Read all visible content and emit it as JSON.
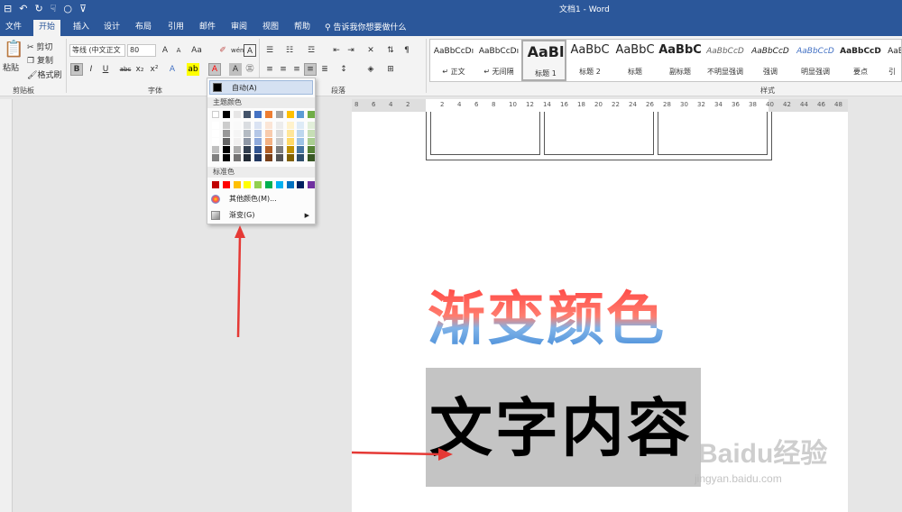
{
  "window": {
    "title": "文档1 - Word"
  },
  "qat": {
    "save": "⊟",
    "undo": "↶",
    "redo": "↻",
    "touch": "☟",
    "circle": "○",
    "more": "⊽"
  },
  "tabs": [
    {
      "label": "文件"
    },
    {
      "label": "开始"
    },
    {
      "label": "插入"
    },
    {
      "label": "设计"
    },
    {
      "label": "布局"
    },
    {
      "label": "引用"
    },
    {
      "label": "邮件"
    },
    {
      "label": "审阅"
    },
    {
      "label": "视图"
    },
    {
      "label": "帮助"
    }
  ],
  "tellme": "告诉我你想要做什么",
  "clipboard": {
    "paste": "粘贴",
    "cut": "剪切",
    "copy": "复制",
    "format_painter": "格式刷",
    "group": "剪贴板"
  },
  "font": {
    "name": "等线 (中文正文",
    "size": "80",
    "group": "字体",
    "bold": "B",
    "italic": "I",
    "underline": "U",
    "strike": "abc",
    "sub": "x₂",
    "sup": "x²",
    "grow": "A",
    "shrink": "A",
    "case": "Aa",
    "color_a": "A"
  },
  "paragraph": {
    "group": "段落"
  },
  "styles": {
    "group": "样式",
    "items": [
      {
        "sample": "AaBbCcDı",
        "name": "↵ 正文"
      },
      {
        "sample": "AaBbCcDı",
        "name": "↵ 无间隔"
      },
      {
        "sample": "AaBl",
        "name": "标题 1"
      },
      {
        "sample": "AaBbC",
        "name": "标题 2"
      },
      {
        "sample": "AaBbC",
        "name": "标题"
      },
      {
        "sample": "AaBbC",
        "name": "副标题"
      },
      {
        "sample": "AaBbCcD",
        "name": "不明显强调"
      },
      {
        "sample": "AaBbCcD",
        "name": "强调"
      },
      {
        "sample": "AaBbCcD",
        "name": "明显强调"
      },
      {
        "sample": "AaBbCcD",
        "name": "要点"
      },
      {
        "sample": "AaBbC",
        "name": "引"
      }
    ]
  },
  "ruler": {
    "labels": [
      "8",
      "6",
      "4",
      "2",
      "",
      "2",
      "4",
      "6",
      "8",
      "10",
      "12",
      "14",
      "16",
      "18",
      "20",
      "22",
      "24",
      "26",
      "28",
      "30",
      "32",
      "34",
      "36",
      "38",
      "40",
      "42",
      "44",
      "46",
      "48"
    ]
  },
  "color_menu": {
    "auto": "自动(A)",
    "theme_header": "主题颜色",
    "standard_header": "标准色",
    "more": "其他颜色(M)...",
    "gradient": "渐变(G)",
    "theme_top": [
      "#ffffff",
      "#000000",
      "#e7e6e6",
      "#44546a",
      "#4472c4",
      "#ed7d31",
      "#a5a5a5",
      "#ffc000",
      "#5b9bd5",
      "#70ad47"
    ],
    "standard": [
      "#c00000",
      "#ff0000",
      "#ffc000",
      "#ffff00",
      "#92d050",
      "#00b050",
      "#00b0f0",
      "#0070c0",
      "#002060",
      "#7030a0"
    ]
  },
  "document": {
    "heading": "渐变颜色",
    "content": "文字内容"
  },
  "watermark": {
    "brand": "Baidu经验",
    "url": "jingyan.baidu.com"
  }
}
